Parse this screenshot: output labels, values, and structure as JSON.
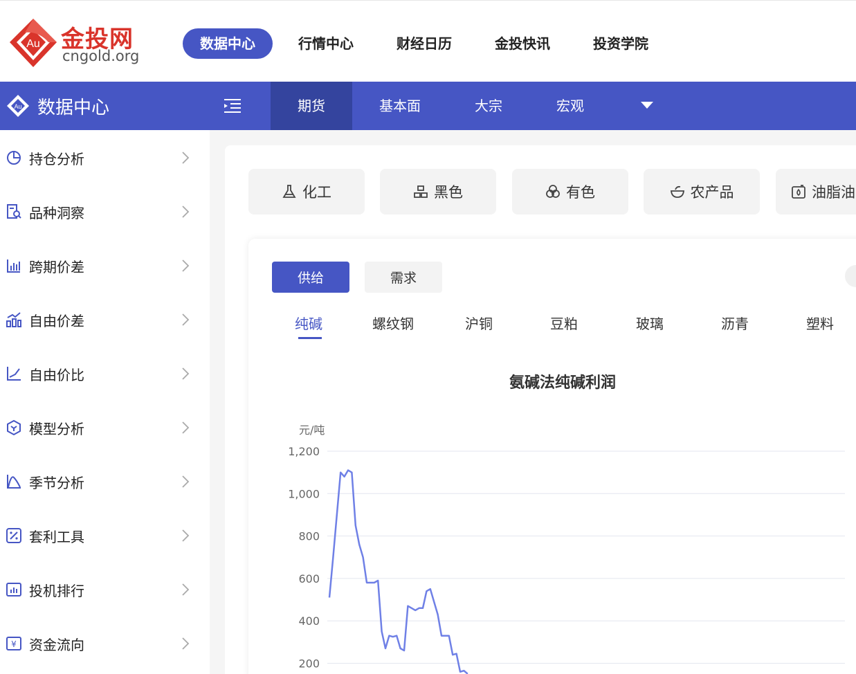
{
  "header": {
    "logo_main": "金投网",
    "logo_sub": "cngold.org",
    "logo_badge": "Au",
    "nav": [
      {
        "label": "数据中心",
        "active": true
      },
      {
        "label": "行情中心",
        "active": false
      },
      {
        "label": "财经日历",
        "active": false
      },
      {
        "label": "金投快讯",
        "active": false
      },
      {
        "label": "投资学院",
        "active": false
      }
    ]
  },
  "bluebar": {
    "brand": "数据中心",
    "tabs": [
      {
        "label": "期货",
        "active": true
      },
      {
        "label": "基本面",
        "active": false
      },
      {
        "label": "大宗",
        "active": false
      },
      {
        "label": "宏观",
        "active": false
      }
    ]
  },
  "sidebar": {
    "items": [
      {
        "label": "持仓分析",
        "icon": "pie-chart-icon"
      },
      {
        "label": "品种洞察",
        "icon": "document-search-icon"
      },
      {
        "label": "跨期价差",
        "icon": "bar-chart-icon"
      },
      {
        "label": "自由价差",
        "icon": "trend-bars-icon"
      },
      {
        "label": "自由价比",
        "icon": "line-axis-icon"
      },
      {
        "label": "模型分析",
        "icon": "hexagon-model-icon"
      },
      {
        "label": "季节分析",
        "icon": "seasonal-curve-icon"
      },
      {
        "label": "套利工具",
        "icon": "percent-box-icon"
      },
      {
        "label": "投机排行",
        "icon": "ranking-box-icon"
      },
      {
        "label": "资金流向",
        "icon": "yuan-box-icon"
      }
    ]
  },
  "categories": [
    {
      "label": "化工",
      "icon": "flask-icon"
    },
    {
      "label": "黑色",
      "icon": "blocks-icon"
    },
    {
      "label": "有色",
      "icon": "metal-rings-icon"
    },
    {
      "label": "农产品",
      "icon": "bowl-icon"
    },
    {
      "label": "油脂油",
      "icon": "oil-box-icon"
    }
  ],
  "segments": [
    {
      "label": "供给",
      "active": true
    },
    {
      "label": "需求",
      "active": false
    }
  ],
  "products": [
    {
      "label": "纯碱",
      "active": true
    },
    {
      "label": "螺纹钢",
      "active": false
    },
    {
      "label": "沪铜",
      "active": false
    },
    {
      "label": "豆粕",
      "active": false
    },
    {
      "label": "玻璃",
      "active": false
    },
    {
      "label": "沥青",
      "active": false
    },
    {
      "label": "塑料",
      "active": false
    }
  ],
  "colors": {
    "accent": "#4656c4",
    "accent_dark": "#34449e",
    "line": "#6f80e6",
    "logo_red": "#d9342b"
  },
  "chart_data": {
    "type": "line",
    "title": "氨碱法纯碱利润",
    "ylabel": "元/吨",
    "xlabel": "",
    "ylim": [
      0,
      1200
    ],
    "yticks": [
      "1,200",
      "1,000",
      "800",
      "600",
      "400",
      "200"
    ],
    "grid": true,
    "series": [
      {
        "values": [
          510,
          700,
          900,
          1100,
          1080,
          1110,
          1100,
          850,
          760,
          700,
          580,
          580,
          580,
          590,
          350,
          270,
          330,
          325,
          330,
          270,
          260,
          470,
          460,
          450,
          460,
          460,
          540,
          550,
          490,
          430,
          330,
          330,
          330,
          240,
          245,
          160,
          165,
          150
        ]
      }
    ]
  }
}
